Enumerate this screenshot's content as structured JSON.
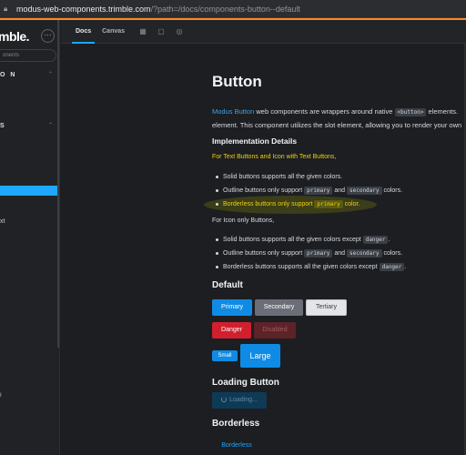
{
  "browser": {
    "host": "modus-web-components.trimble.com",
    "path": "/?path=/docs/components-button--default"
  },
  "sidebar": {
    "brand": "mble.",
    "more": "···",
    "search_placeholder": "onents",
    "section1": "O N",
    "section2": "S",
    "collapse1": "⌃",
    "collapse2": "⌃",
    "item_t": "xt",
    "item_tiny": "I"
  },
  "toolbar": {
    "tabs": [
      "Docs",
      "Canvas"
    ],
    "icons": [
      "grid-icon",
      "frame-icon",
      "target-icon"
    ]
  },
  "doc": {
    "title": "Button",
    "intro_link": "Modus Button",
    "intro_text": " web components are wrappers around native ",
    "intro_code": "<button>",
    "intro_text2": " elements.",
    "intro_line2": "element. This component utilizes the slot element, allowing you to render your own",
    "impl_title": "Implementation Details",
    "text_buttons_line": "For Text Buttons and Icon with Text Buttons,",
    "list1": [
      {
        "pre": "Solid buttons supports all the given colors.",
        "code1": "",
        "mid": "",
        "code2": "",
        "post": ""
      },
      {
        "pre": "Outline buttons only support ",
        "code1": "primary",
        "mid": " and ",
        "code2": "secondary",
        "post": " colors."
      },
      {
        "pre": "Borderless buttons only support ",
        "code1": "primary",
        "mid": " color.",
        "code2": "",
        "post": ""
      }
    ],
    "icon_only_line": "For Icon only Buttons,",
    "list2": [
      {
        "pre": "Solid buttons supports all the given colors except ",
        "code1": "danger",
        "post": "."
      },
      {
        "pre": "Outline buttons only support ",
        "code1": "primary",
        "mid": " and ",
        "code2": "secondary",
        "post": " colors."
      },
      {
        "pre": "Borderless buttons supports all the given colors except ",
        "code1": "danger",
        "post": "."
      }
    ],
    "default_title": "Default",
    "buttons": {
      "primary": "Primary",
      "secondary": "Secondary",
      "tertiary": "Tertiary",
      "danger": "Danger",
      "disabled": "Disabled",
      "small": "Small",
      "large": "Large"
    },
    "loading_title": "Loading Button",
    "loading_label": "Loading...",
    "borderless_title": "Borderless",
    "borderless_label": "Borderless"
  },
  "colors": {
    "accent": "#1ea7fd",
    "primary": "#0f8be6",
    "danger": "#d21f2d",
    "highlight": "#f1d10a"
  }
}
